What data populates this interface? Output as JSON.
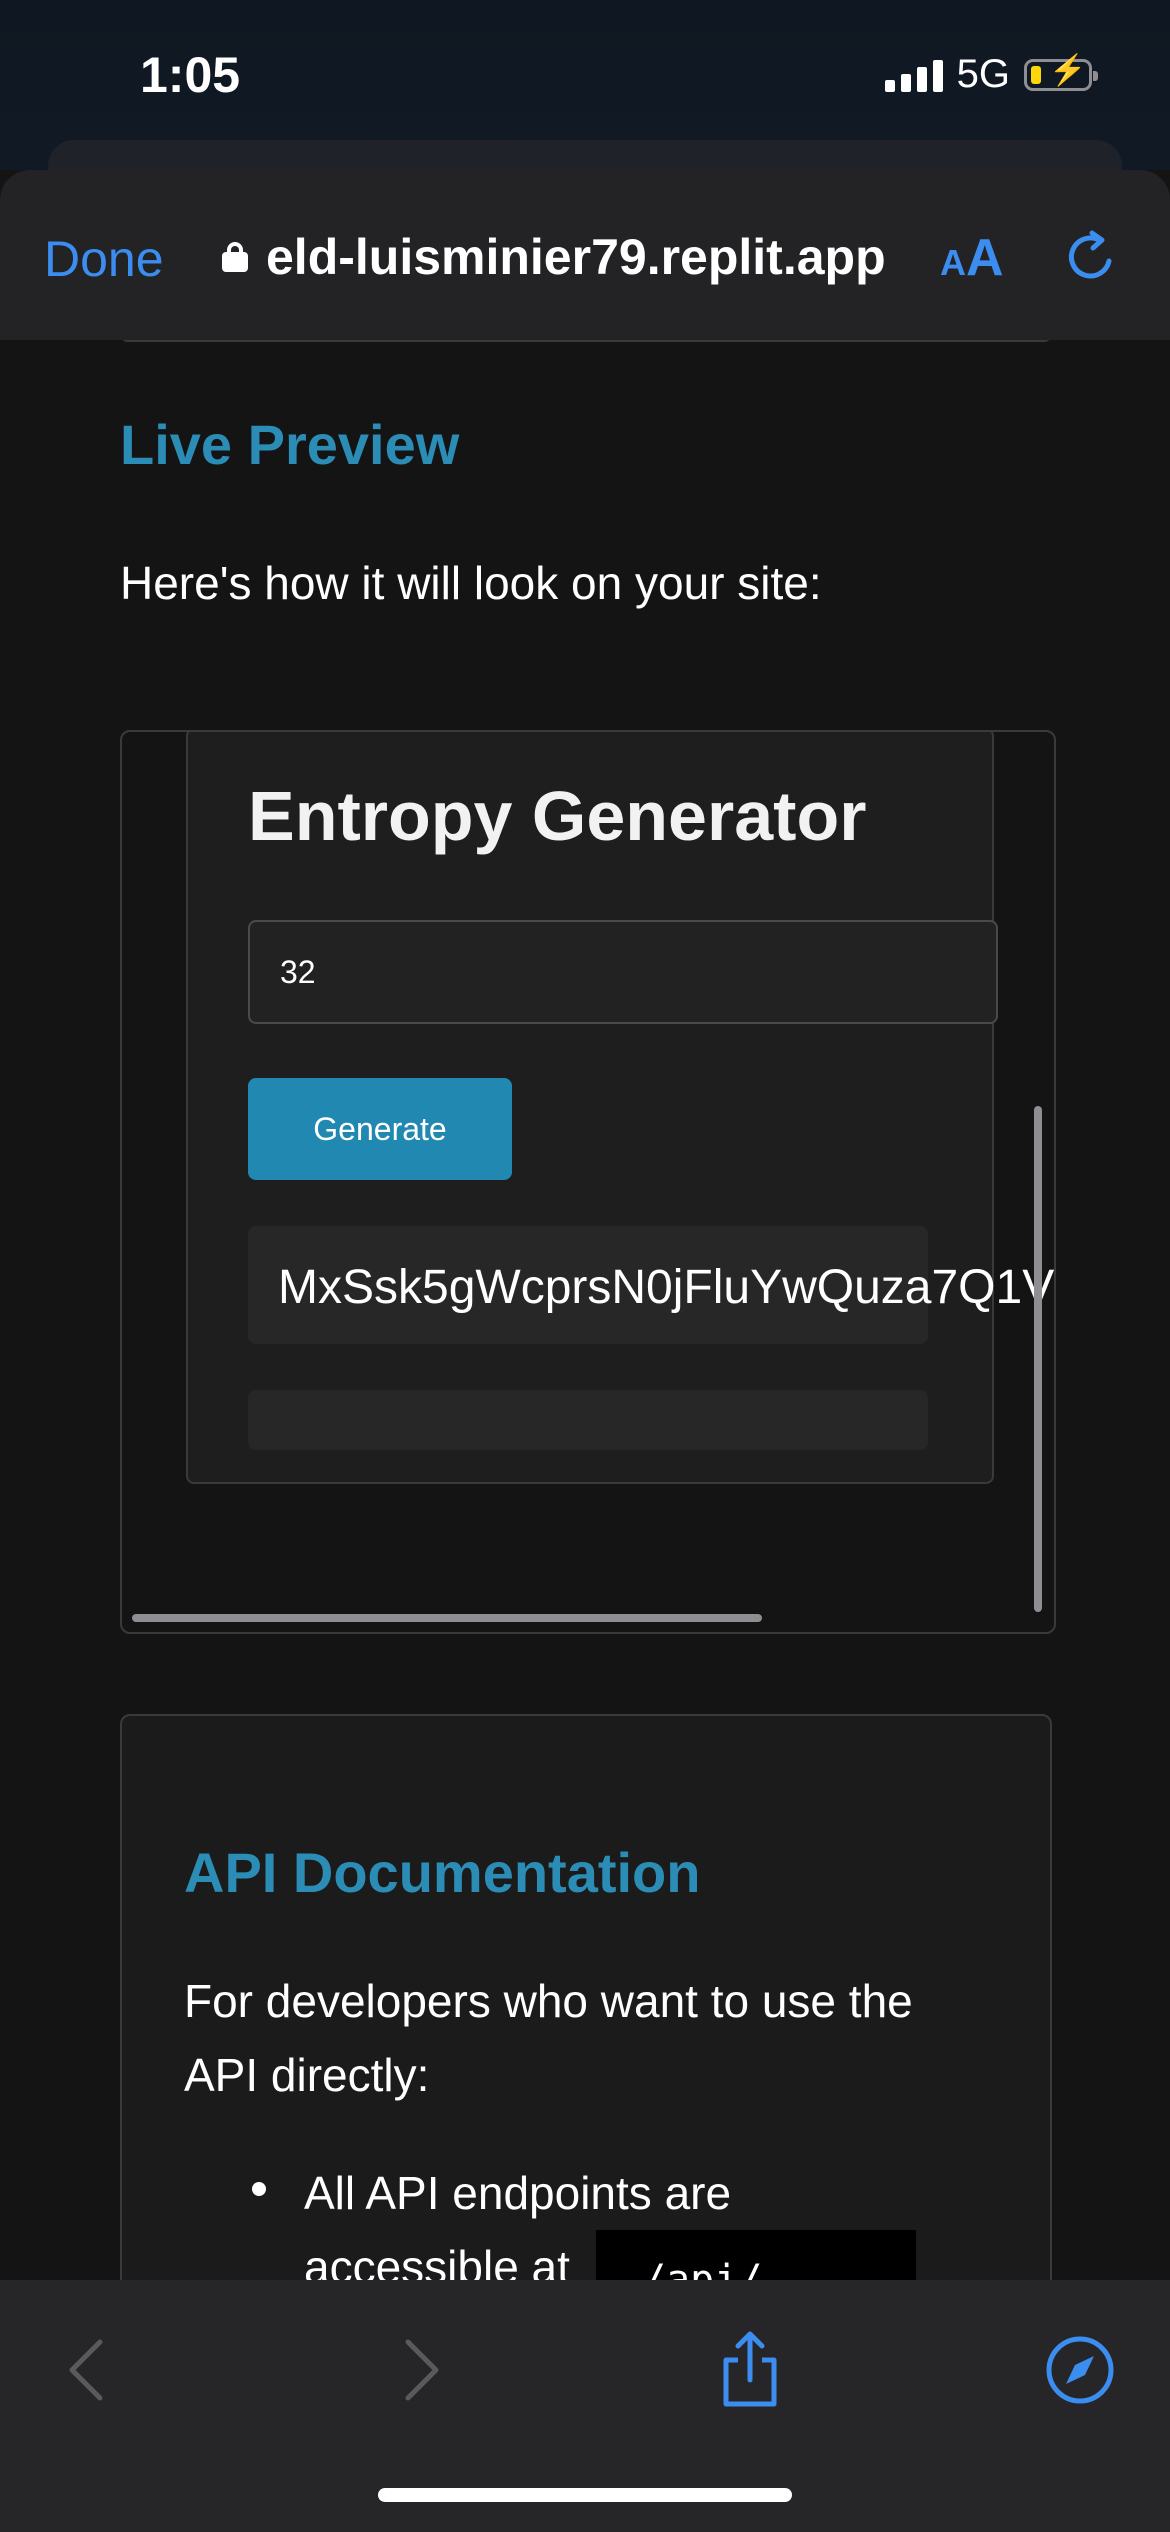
{
  "status_bar": {
    "time": "1:05",
    "network": "5G"
  },
  "browser": {
    "done_label": "Done",
    "url": "eld-luisminier79.replit.app",
    "text_size_label_small": "A",
    "text_size_label_large": "A"
  },
  "page": {
    "live_preview_title": "Live Preview",
    "live_preview_desc": "Here's how it will look on your site:",
    "widget": {
      "title": "Entropy Generator",
      "length_value": "32",
      "generate_label": "Generate",
      "output": "MxSsk5gWcprsN0jFluYwQuza7Q1V"
    },
    "api": {
      "title": "API Documentation",
      "desc_line1": "For developers who want to use the",
      "desc_line2": "API directly:",
      "item1_line1": "All API endpoints are",
      "item1_line2": "accessible at",
      "code": "/api/"
    }
  },
  "colors": {
    "accent": "#2b8db5",
    "link": "#3b8ef0",
    "button": "#2188b1"
  }
}
